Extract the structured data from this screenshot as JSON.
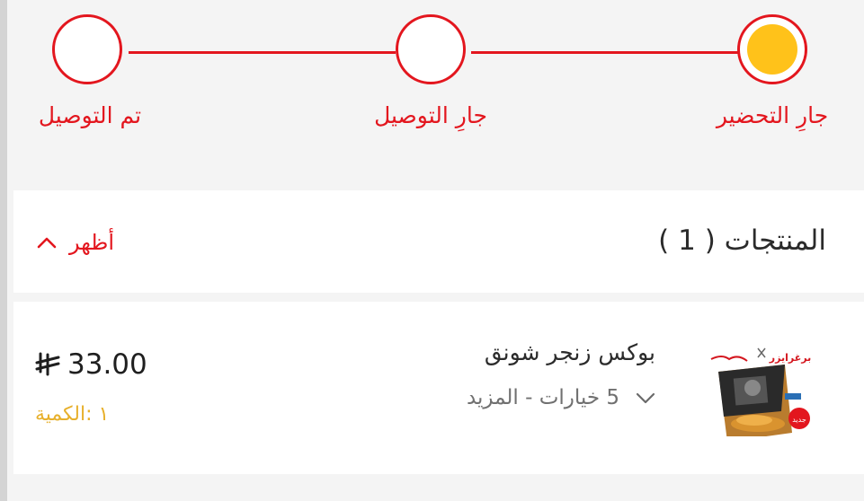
{
  "stepper": {
    "steps": [
      {
        "label": "جارِ التحضير",
        "active": true
      },
      {
        "label": "جارِ التوصيل",
        "active": false
      },
      {
        "label": "تم التوصيل",
        "active": false
      }
    ],
    "colors": {
      "accent": "#e3161e",
      "active_dot": "#ffc21a"
    }
  },
  "products_section": {
    "title": "المنتجات ( 1 )",
    "toggle_label": "أظهر",
    "toggle_icon": "chevron-up-icon"
  },
  "products": [
    {
      "name": "بوكس زنجر شونق",
      "options_label": "5 خيارات - المزيد",
      "options_icon": "chevron-down-icon",
      "price": "33.00",
      "currency_icon": "riyal-symbol-icon",
      "quantity_label": "١ :الكمية",
      "image": "product-box-image",
      "image_brand_text": "برغرايزر",
      "image_badge_text": "جديد"
    }
  ]
}
